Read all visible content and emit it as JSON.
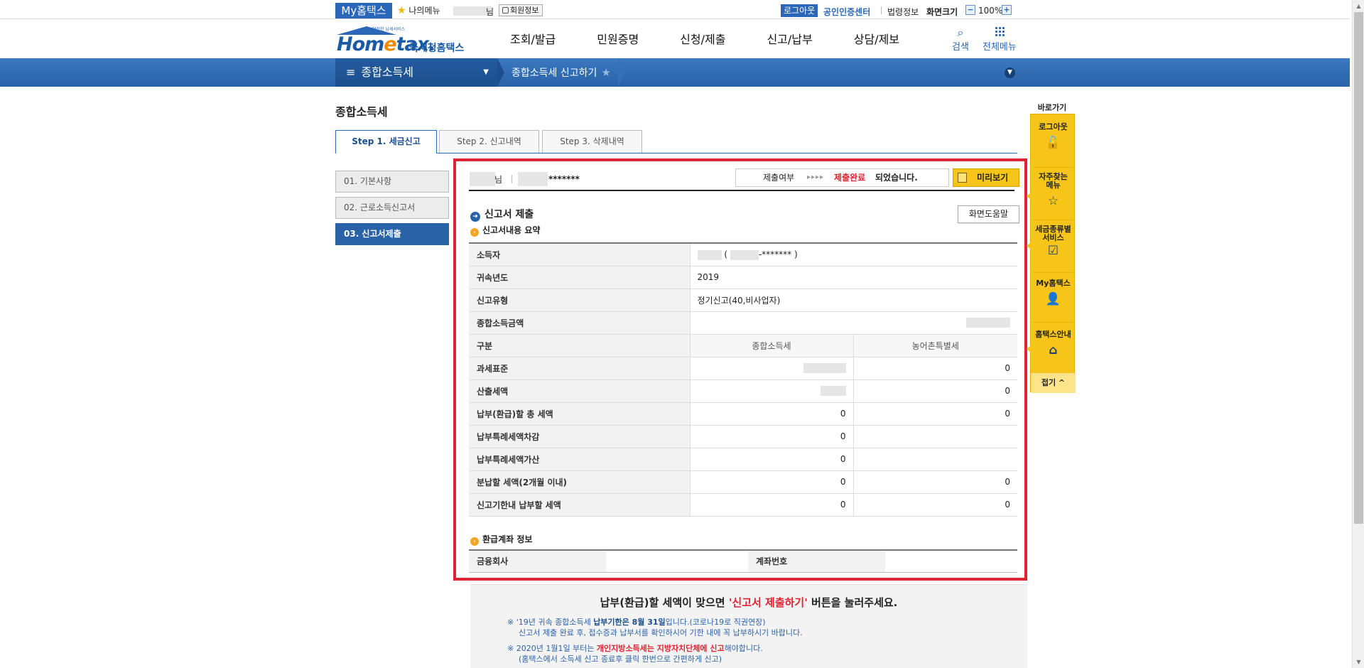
{
  "topbar": {
    "my_hometax": "My홈택스",
    "my_menu": "나의메뉴",
    "user_suffix": "님",
    "member_info": "회원정보",
    "logout": "로그아웃",
    "cert_center": "공인인증센터",
    "law_info": "법령정보",
    "screen_size": "화면크기",
    "zoom_minus": "−",
    "zoom_value": "100%",
    "zoom_plus": "+"
  },
  "header": {
    "logo_slogan": "안전한 납세서비스",
    "logo_word_a": "Hom",
    "logo_word_e": "e",
    "logo_word_b": "tax.",
    "logo_kor": "국세청홈택스",
    "nav": [
      "조회/발급",
      "민원증명",
      "신청/제출",
      "신고/납부",
      "상담/제보"
    ],
    "search": "검색",
    "all_menu": "전체메뉴"
  },
  "subbar": {
    "current_menu": "종합소득세",
    "breadcrumb": "종합소득세 신고하기"
  },
  "page": {
    "title": "종합소득세",
    "tabs": [
      "Step 1. 세금신고",
      "Step 2. 신고내역",
      "Step 3. 삭제내역"
    ],
    "steps": [
      "01. 기본사항",
      "02. 근로소득신고서",
      "03. 신고서제출"
    ]
  },
  "main": {
    "name_suffix": "님",
    "id_stars": "*******",
    "status_label": "제출여부",
    "status_dots": "▸▸▸▸",
    "status_done": "제출완료",
    "status_rest": "되었습니다.",
    "preview": "미리보기",
    "section_title": "신고서 제출",
    "help": "화면도움말",
    "summary_title": "신고서내용 요약",
    "rows": {
      "taxpayer_label": "소득자",
      "taxpayer_paren_open": "(",
      "taxpayer_id_stars": "-*******",
      "taxpayer_paren_close": ")",
      "year_label": "귀속년도",
      "year_value": "2019",
      "type_label": "신고유형",
      "type_value": "정기신고(40,비사업자)",
      "total_income_label": "종합소득금액",
      "category_label": "구분",
      "col_income_tax": "종합소득세",
      "col_rural_tax": "농어촌특별세",
      "tax_base_label": "과세표준",
      "tax_base_rural": "0",
      "calc_tax_label": "산출세액",
      "calc_tax_rural": "0",
      "total_payable_label": "납부(환급)할 총 세액",
      "total_payable_income": "0",
      "total_payable_rural": "0",
      "special_deduct_label": "납부특례세액차감",
      "special_deduct_income": "0",
      "special_add_label": "납부특례세액가산",
      "special_add_income": "0",
      "installment_label": "분납할 세액(2개월 이내)",
      "installment_income": "0",
      "installment_rural": "0",
      "due_label": "신고기한내 납부할 세액",
      "due_income": "0",
      "due_rural": "0"
    },
    "refund_title": "환급계좌 정보",
    "refund_bank_label": "금융회사",
    "refund_account_label": "계좌번호"
  },
  "notice": {
    "headline_a": "납부(환급)할 세액이 맞으면 ",
    "headline_red": "'신고서 제출하기'",
    "headline_b": " 버튼을 눌러주세요.",
    "line1_a": "※ '19년 귀속 종합소득세 ",
    "line1_b": "납부기한은 8월 31일",
    "line1_c": "입니다.(코로나19로 직권연장)",
    "line2": "신고서 제출 완료 후, 접수증과 납부서를 확인하시어 기한 내에 꼭 납부하시기 바랍니다.",
    "line3_a": "※ 2020년 1월1일 부터는 ",
    "line3_b": "개인지방소득세는 지방자치단체에 신고",
    "line3_c": "해야합니다.",
    "line4": "(홈택스에서 소득세 신고 종료후 클릭 한번으로 간편하게 신고)"
  },
  "quick": {
    "title": "바로가기",
    "items": [
      "로그아웃",
      "자주찾는메뉴",
      "세금종류별서비스",
      "My홈택스",
      "홈택스안내"
    ],
    "fold": "접기"
  },
  "colors": {
    "primary": "#2a67b8",
    "highlight_red": "#e02231",
    "quick_yellow": "#f7c51a"
  }
}
